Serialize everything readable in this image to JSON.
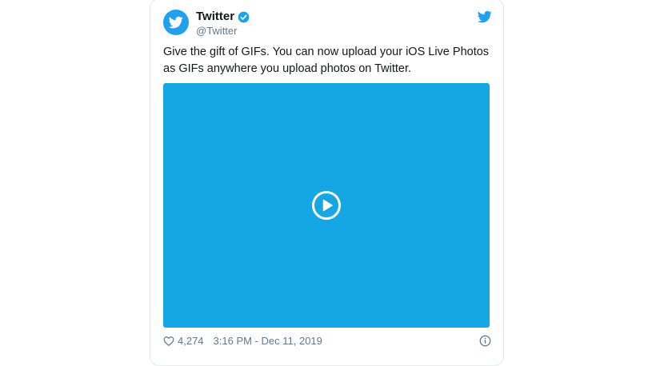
{
  "author": {
    "name": "Twitter",
    "handle": "@Twitter",
    "verified": true,
    "avatar_icon": "twitter-bird-icon"
  },
  "brand_icon": "twitter-bird-icon",
  "tweet": {
    "text": "Give the gift of GIFs. You can now upload your iOS Live Photos as GIFs anywhere you upload photos on Twitter."
  },
  "media": {
    "type": "video",
    "background_color": "#15a7e5",
    "play_icon": "play-circle-icon"
  },
  "footer": {
    "like_icon": "heart-outline-icon",
    "like_count": "4,274",
    "timestamp": "3:16 PM - Dec 11, 2019",
    "info_icon": "info-icon"
  },
  "colors": {
    "brand": "#1da1f2",
    "text": "#14171a",
    "secondary": "#657786",
    "border": "#e1e8ed"
  }
}
